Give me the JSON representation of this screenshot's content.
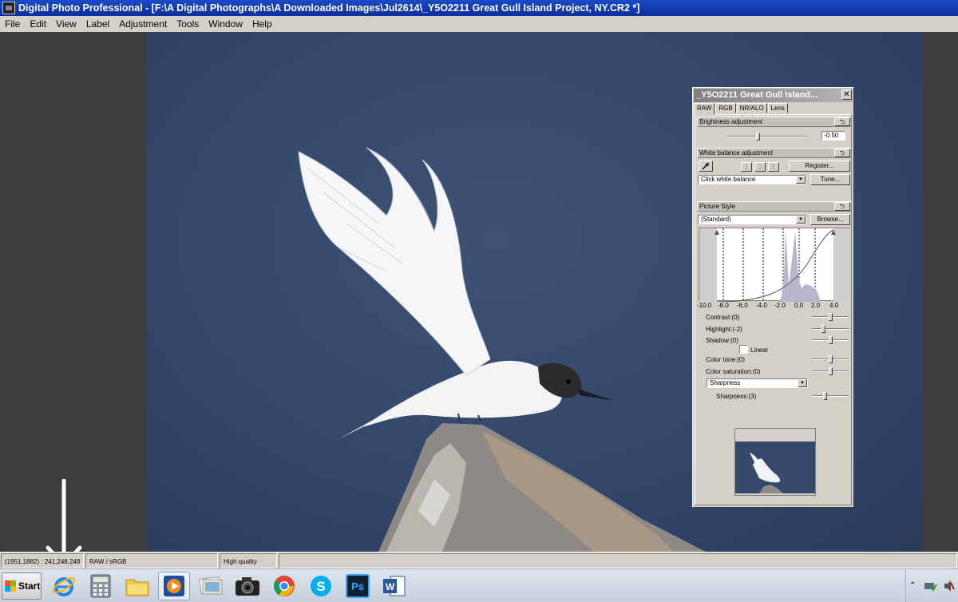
{
  "window": {
    "title": "Digital Photo Professional - [F:\\A Digital Photographs\\A Downloaded Images\\Jul2614\\_Y5O2211  Great Gull Island Project, NY.CR2 *]"
  },
  "menu": [
    "File",
    "Edit",
    "View",
    "Label",
    "Adjustment",
    "Tools",
    "Window",
    "Help"
  ],
  "status": {
    "coords": "(1951,1882) : 241,248,248",
    "mode": "RAW / sRGB",
    "quality": "High quality"
  },
  "palette": {
    "title": "_Y5O2211  Great Gull Island...",
    "close": "✕",
    "tabs": [
      "RAW",
      "RGB",
      "NR/ALO",
      "Lens"
    ],
    "active_tab": "RAW",
    "brightness": {
      "header": "Brightness adjustment",
      "value": "-0.50",
      "slider_level": 0.38
    },
    "white_balance": {
      "header": "White balance adjustment",
      "presets": [
        "1",
        "2",
        "3"
      ],
      "register_label": "Register...",
      "mode": "Click white balance",
      "tune_label": "Tune..."
    },
    "picture_style": {
      "header": "Picture Style",
      "style": "(Standard)",
      "browse_label": "Browse...",
      "curve_ticks": [
        "-10.0",
        "-8.0",
        "-6.0",
        "-4.0",
        "-2.0",
        "0.0",
        "2.0",
        "4.0"
      ],
      "contrast": {
        "label": "Contrast:(0)",
        "level": 0.5
      },
      "highlight": {
        "label": "Highlight:(-2)",
        "level": 0.3
      },
      "shadow": {
        "label": "Shadow:(0)",
        "level": 0.5
      },
      "linear_label": "Linear",
      "color_tone": {
        "label": "Color tone:(0)",
        "level": 0.5
      },
      "color_saturation": {
        "label": "Color saturation:(0)",
        "level": 0.5
      },
      "sharp_mode": "Sharpness",
      "sharpness": {
        "label": "Sharpness:(3)",
        "level": 0.33
      }
    }
  },
  "taskbar": {
    "start_label": "Start",
    "apps": [
      "internet-explorer-icon",
      "calculator-icon",
      "file-explorer-icon",
      "media-player-icon",
      "photo-viewer-icon",
      "camera-icon",
      "chrome-icon",
      "skype-icon",
      "photoshop-icon",
      "word-icon"
    ],
    "photoshop_label": "Ps",
    "word_label": "W"
  },
  "colors": {
    "titlebar": "#0a2e9e",
    "photo_background": "#33476a",
    "chrome": "#d4d0c8"
  }
}
